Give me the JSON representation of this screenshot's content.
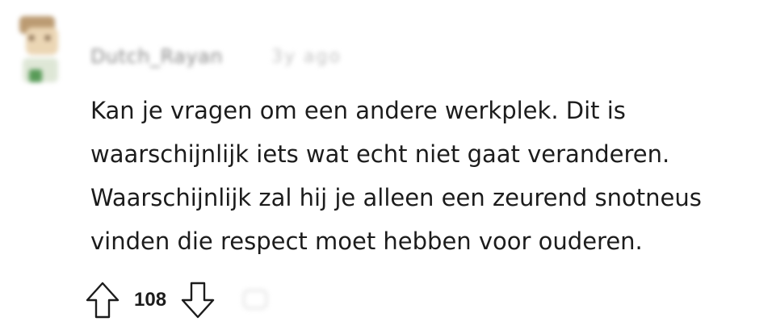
{
  "comment": {
    "author": {
      "username": "Dutch_Rayan",
      "avatar_icon": "user-avatar-icon"
    },
    "timestamp": "3y ago",
    "body_lines": [
      "Kan je vragen om een andere werkplek. Dit is",
      "waarschijnlijk iets wat echt niet gaat veranderen.",
      "Waarschijnlijk zal hij je alleen een zeurend snotneus",
      "vinden die respect moet hebben voor ouderen."
    ],
    "votes": {
      "score": "108",
      "upvote_icon": "upvote-arrow-icon",
      "downvote_icon": "downvote-arrow-icon"
    }
  }
}
